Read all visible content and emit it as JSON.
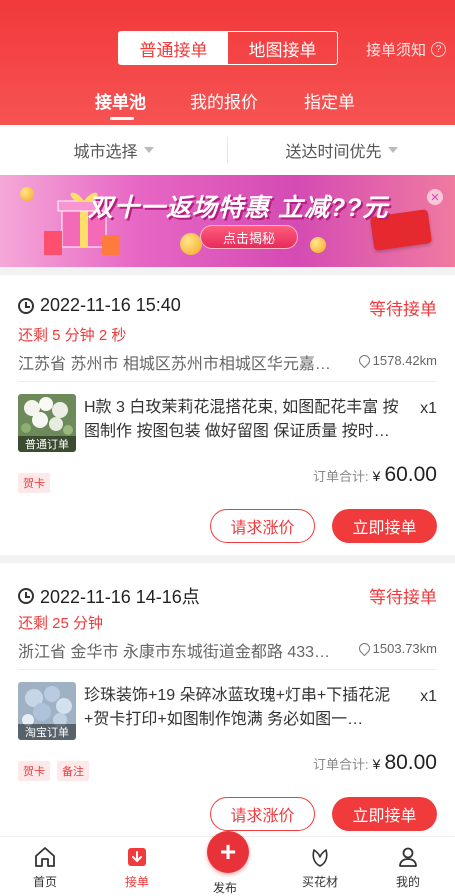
{
  "header": {
    "segments": [
      "普通接单",
      "地图接单"
    ],
    "notice": "接单须知",
    "notice_icon": "question-circle-icon",
    "tabs": [
      "接单池",
      "我的报价",
      "指定单"
    ],
    "accent_color": "#f03a3b"
  },
  "filters": {
    "city": "城市选择",
    "sort": "送达时间优先"
  },
  "banner": {
    "title": "双十一返场特惠 立减",
    "title_suffix": "??元",
    "button": "点击揭秘"
  },
  "orders": [
    {
      "time": "2022-11-16 15:40",
      "status": "等待接单",
      "remaining": "还剩 5 分钟 2 秒",
      "address": "江苏省 苏州市 相城区苏州市相城区华元嘉…",
      "distance": "1578.42km",
      "thumb_label": "普通订单",
      "description": "H款 3 白玫茉莉花混搭花束, 如图配花丰富 按图制作 按图包装 做好留图 保证质量 按时…",
      "quantity": "x1",
      "tags": [
        "贺卡"
      ],
      "total_label": "订单合计:",
      "currency": "¥",
      "amount": "60.00",
      "btn_raise": "请求涨价",
      "btn_accept": "立即接单"
    },
    {
      "time": "2022-11-16 14-16点",
      "status": "等待接单",
      "remaining": "还剩 25 分钟",
      "address": "浙江省 金华市 永康市东城街道金都路 433…",
      "distance": "1503.73km",
      "thumb_label": "淘宝订单",
      "description": "珍珠装饰+19 朵碎冰蓝玫瑰+灯串+下插花泥+贺卡打印+如图制作饱满 务必如图一…",
      "quantity": "x1",
      "tags": [
        "贺卡",
        "备注"
      ],
      "total_label": "订单合计:",
      "currency": "¥",
      "amount": "80.00",
      "btn_raise": "请求涨价",
      "btn_accept": "立即接单"
    }
  ],
  "bottom_nav": {
    "items": [
      {
        "label": "首页",
        "icon": "home-icon"
      },
      {
        "label": "接单",
        "icon": "order-icon"
      },
      {
        "label": "发布",
        "icon": "plus-icon"
      },
      {
        "label": "买花材",
        "icon": "flower-icon"
      },
      {
        "label": "我的",
        "icon": "user-icon"
      }
    ]
  }
}
